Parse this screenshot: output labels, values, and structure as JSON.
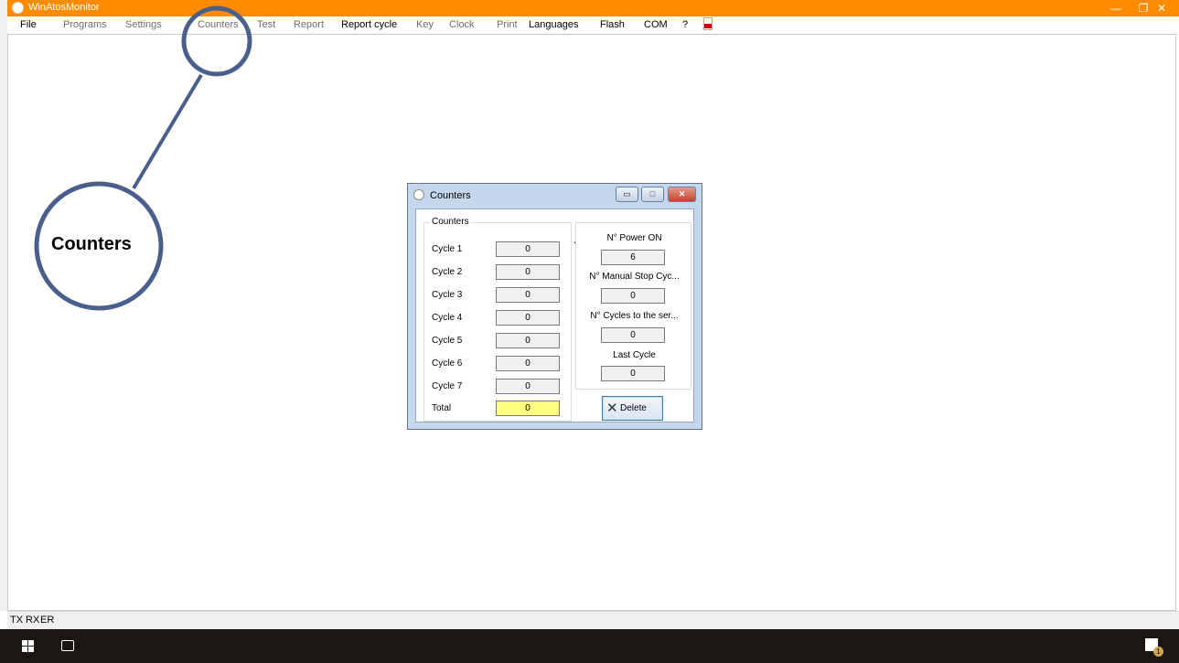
{
  "window": {
    "title": "WinAtosMonitor",
    "controls": {
      "minimize": "—",
      "restore": "❐",
      "close": "✕"
    }
  },
  "menu": {
    "items": [
      {
        "label": "File",
        "enabled": true
      },
      {
        "label": "Programs",
        "enabled": false
      },
      {
        "label": "Settings",
        "enabled": false
      },
      {
        "label": "Counters",
        "enabled": false
      },
      {
        "label": "Test",
        "enabled": false
      },
      {
        "label": "Report",
        "enabled": false
      },
      {
        "label": "Report cycle",
        "enabled": true
      },
      {
        "label": "Key",
        "enabled": false
      },
      {
        "label": "Clock",
        "enabled": false
      },
      {
        "label": "Print",
        "enabled": false
      },
      {
        "label": "Languages",
        "enabled": true
      },
      {
        "label": "Flash",
        "enabled": true
      },
      {
        "label": "COM",
        "enabled": true
      },
      {
        "label": "?",
        "enabled": true
      }
    ],
    "pdf_icon": "pdf-icon"
  },
  "status": {
    "tx": "TX",
    "rx": "RX",
    "er": "ER"
  },
  "taskbar": {
    "notification_count": "1"
  },
  "dialog": {
    "title": "Counters",
    "controls": {
      "minimize": "▭",
      "maximize": "□",
      "close": "✕"
    },
    "group_title": "Counters",
    "cycles": [
      {
        "label": "Cycle 1",
        "value": "0"
      },
      {
        "label": "Cycle 2",
        "value": "0"
      },
      {
        "label": "Cycle 3",
        "value": "0"
      },
      {
        "label": "Cycle 4",
        "value": "0"
      },
      {
        "label": "Cycle 5",
        "value": "0"
      },
      {
        "label": "Cycle 6",
        "value": "0"
      },
      {
        "label": "Cycle 7",
        "value": "0"
      }
    ],
    "total": {
      "label": "Total",
      "value": "0"
    },
    "dot": ".",
    "power_on": {
      "label": "N° Power ON",
      "value": "6"
    },
    "manual_stop": {
      "label": "N° Manual Stop Cyc...",
      "value": "0"
    },
    "cycles_to_service": {
      "label": "N° Cycles to the ser...",
      "value": "0"
    },
    "last_cycle": {
      "label": "Last Cycle",
      "value": "0"
    },
    "delete_button": {
      "label": "Delete",
      "icon": "x-icon"
    }
  },
  "callout": {
    "label": "Counters",
    "color": "#4a5f8c"
  }
}
